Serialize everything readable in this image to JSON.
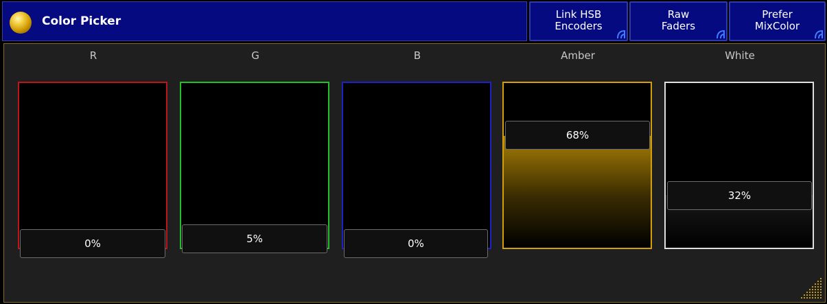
{
  "window": {
    "title": "Color Picker",
    "accent_color": "#d4a006",
    "title_bar_color": "#050a80"
  },
  "toolbar": {
    "buttons": [
      {
        "line1": "Link HSB",
        "line2": "Encoders"
      },
      {
        "line1": "Raw",
        "line2": "Faders"
      },
      {
        "line1": "Prefer",
        "line2": "MixColor"
      }
    ]
  },
  "faders": [
    {
      "label": "R",
      "value": 0,
      "value_text": "0%",
      "color": "#c0141c"
    },
    {
      "label": "G",
      "value": 5,
      "value_text": "5%",
      "color": "#22c02a"
    },
    {
      "label": "B",
      "value": 0,
      "value_text": "0%",
      "color": "#1a22c8"
    },
    {
      "label": "Amber",
      "value": 68,
      "value_text": "68%",
      "color": "#d4a006"
    },
    {
      "label": "White",
      "value": 32,
      "value_text": "32%",
      "color": "#e0e0e0"
    }
  ]
}
